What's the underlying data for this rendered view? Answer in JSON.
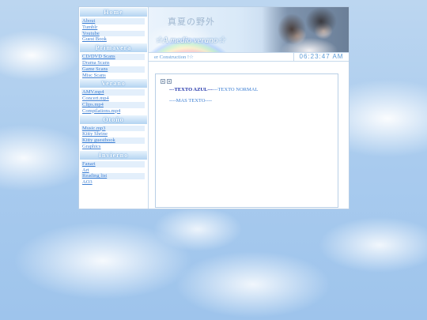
{
  "sidebar": {
    "sections": [
      {
        "title": "Home",
        "links": [
          "About",
          "Tumblr",
          "Youtube",
          "Guest Book"
        ]
      },
      {
        "title": "Primavera",
        "links": [
          "CD/DVD Scans",
          "Drama Scans",
          "Game Scans",
          "Misc Scans"
        ]
      },
      {
        "title": "Verano",
        "links": [
          "AMV.mp4",
          "Concert.mp4",
          "Clips.mp4",
          "Compilations.mp4"
        ]
      },
      {
        "title": "Otoño",
        "links": [
          "Music.mp3",
          "Kitty Shrine",
          "Kitty guestbook",
          "Graphics"
        ]
      },
      {
        "title": "Invierno",
        "links": [
          "Fanart",
          "Art",
          "Reading list",
          "AO3"
        ]
      }
    ]
  },
  "banner": {
    "jp_title": "真夏の野外",
    "en_title": "☆A medio verano☆"
  },
  "status": {
    "marquee": "er Construction !☆",
    "clock": "06:23:47 AM"
  },
  "content": {
    "bold_text": "---TEXTO AZUL---",
    "normal_text": "---TEXTO NORMAL",
    "line2": "----MAS TEXTO----"
  },
  "colors": {
    "link": "#3d7fd3",
    "heading_bg": "#b4d4f2",
    "accent_dark": "#1c2fa8"
  }
}
